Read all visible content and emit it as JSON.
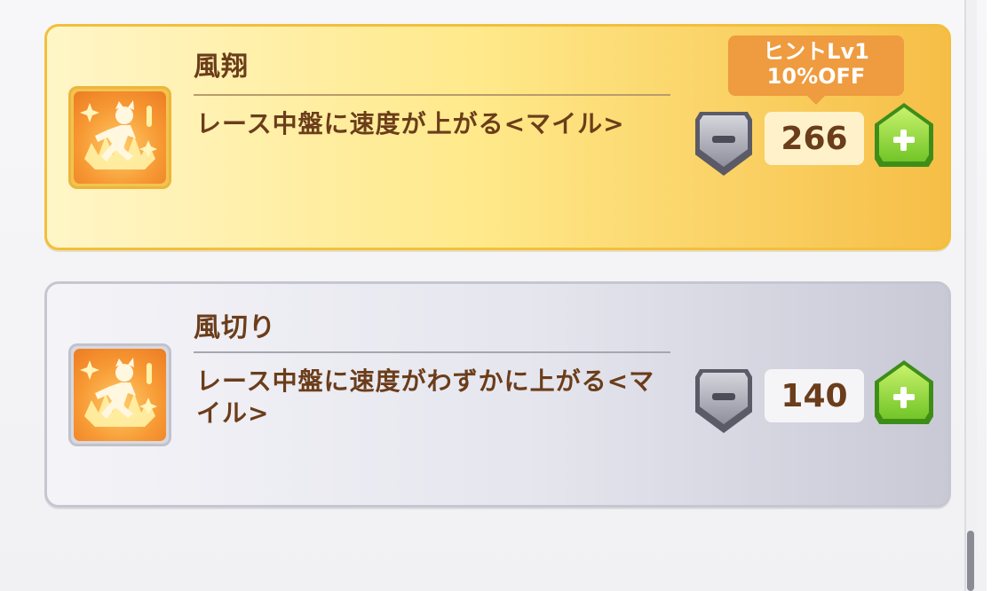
{
  "skills": [
    {
      "name": "風翔",
      "description": "レース中盤に速度が上がる<マイル>",
      "count": "266",
      "hint": {
        "line1": "ヒントLv1",
        "line2": "10%OFF"
      },
      "theme": "gold",
      "icon": "running-character-icon"
    },
    {
      "name": "風切り",
      "description": "レース中盤に速度がわずかに上がる<マイル>",
      "count": "140",
      "theme": "silver",
      "icon": "running-character-icon"
    }
  ],
  "colors": {
    "gold_card": "#ffe98a",
    "silver_card": "#e5e5ee",
    "text_brown": "#6b3d1a",
    "hint_orange": "#ef9b3f",
    "plus_green": "#72c528",
    "minus_gray": "#8f8f9c"
  }
}
